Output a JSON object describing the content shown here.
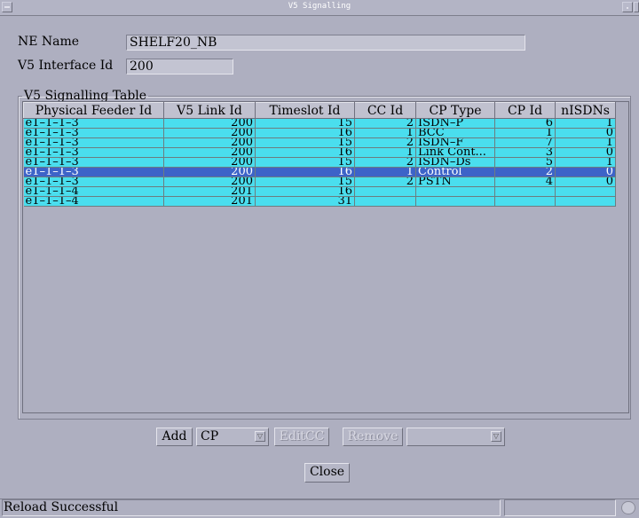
{
  "window": {
    "title": "V5 Signalling"
  },
  "form": {
    "ne_name_label": "NE Name",
    "ne_name_value": "SHELF20_NB",
    "v5_interface_label": "V5 Interface Id",
    "v5_interface_value": "200"
  },
  "table": {
    "group_title": "V5 Signalling Table",
    "columns": [
      "Physical Feeder Id",
      "V5 Link Id",
      "Timeslot Id",
      "CC Id",
      "CP Type",
      "CP Id",
      "nISDNs"
    ],
    "rows": [
      [
        "e1–1–1–3",
        "200",
        "15",
        "2",
        "ISDN–P",
        "6",
        "1"
      ],
      [
        "e1–1–1–3",
        "200",
        "16",
        "1",
        "BCC",
        "1",
        "0"
      ],
      [
        "e1–1–1–3",
        "200",
        "15",
        "2",
        "ISDN–F",
        "7",
        "1"
      ],
      [
        "e1–1–1–3",
        "200",
        "16",
        "1",
        "Link Cont...",
        "3",
        "0"
      ],
      [
        "e1–1–1–3",
        "200",
        "15",
        "2",
        "ISDN–Ds",
        "5",
        "1"
      ],
      [
        "e1–1–1–3",
        "200",
        "16",
        "1",
        "Control",
        "2",
        "0"
      ],
      [
        "e1–1–1–3",
        "200",
        "15",
        "2",
        "PSTN",
        "4",
        "0"
      ],
      [
        "e1–1–1–4",
        "201",
        "16",
        "",
        "",
        "",
        ""
      ],
      [
        "e1–1–1–4",
        "201",
        "31",
        "",
        "",
        "",
        ""
      ]
    ],
    "selected_row": 5
  },
  "actions": {
    "add_label": "Add",
    "type_select_value": "CP",
    "editcc_label": "EditCC",
    "remove_label": "Remove",
    "second_select_value": "",
    "close_label": "Close"
  },
  "status": {
    "text": "Reload Successful"
  },
  "colors": {
    "row_bg": "#4adeee",
    "selected_bg": "#3d63c8",
    "window_bg": "#aeafc0"
  }
}
